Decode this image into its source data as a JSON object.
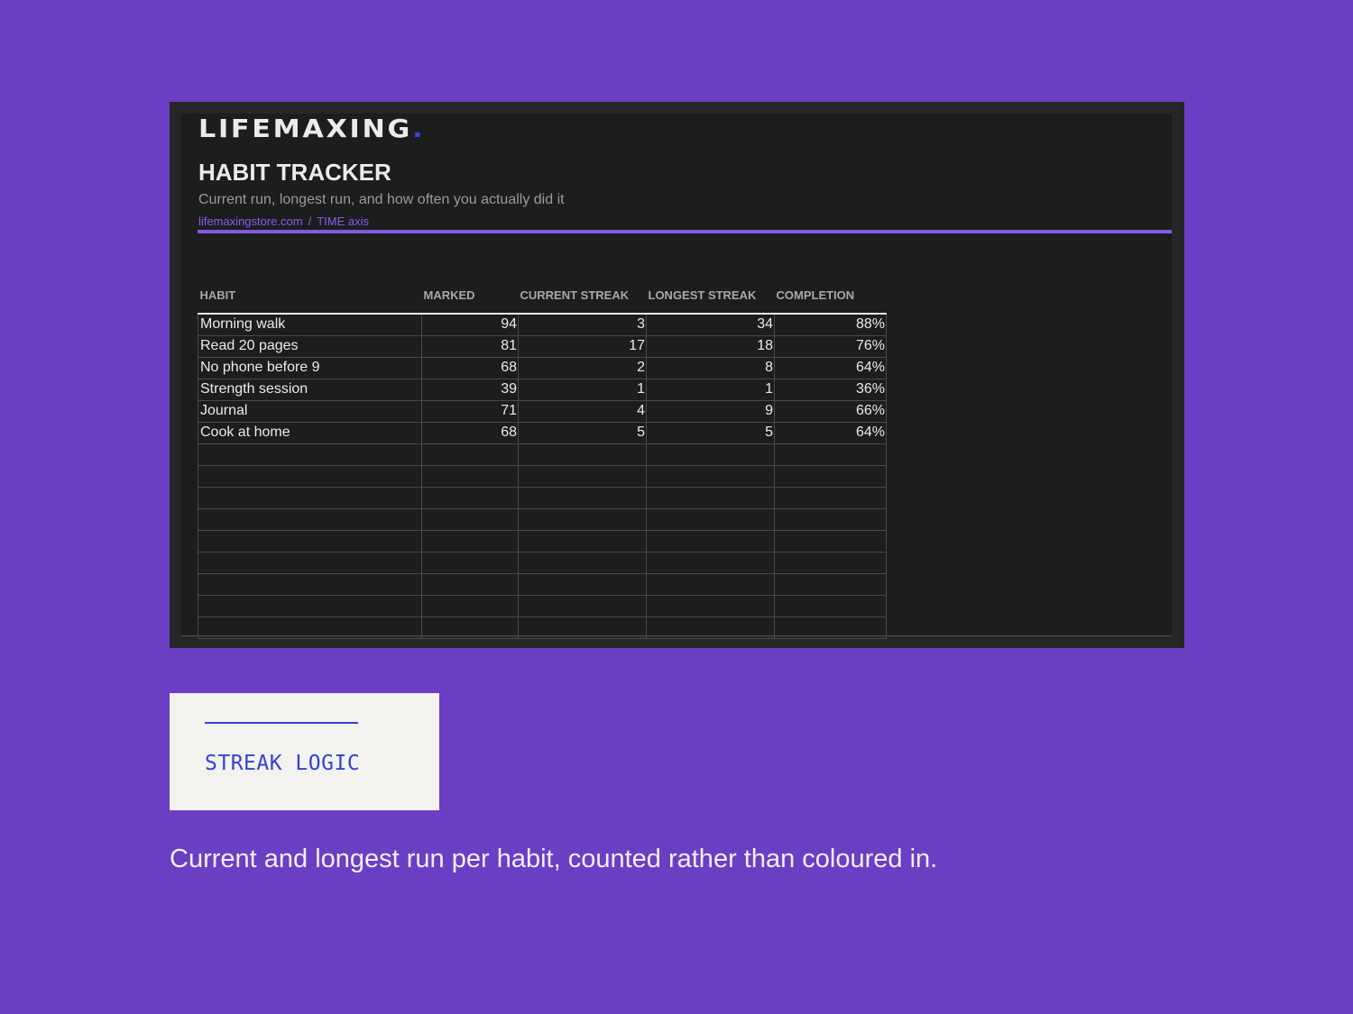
{
  "brand": {
    "name": "LIFEMAXING",
    "dot": "."
  },
  "header": {
    "title": "HABIT TRACKER",
    "subtitle": "Current run, longest run, and how often you actually did it",
    "source_site": "lifemaxingstore.com",
    "source_separator": "/",
    "source_axis": "TIME axis"
  },
  "table": {
    "columns": [
      "HABIT",
      "MARKED",
      "CURRENT STREAK",
      "LONGEST STREAK",
      "COMPLETION"
    ],
    "rows": [
      [
        "Morning walk",
        "94",
        "3",
        "34",
        "88%"
      ],
      [
        "Read 20 pages",
        "81",
        "17",
        "18",
        "76%"
      ],
      [
        "No phone before 9",
        "68",
        "2",
        "8",
        "64%"
      ],
      [
        "Strength session",
        "39",
        "1",
        "1",
        "36%"
      ],
      [
        "Journal",
        "71",
        "4",
        "9",
        "66%"
      ],
      [
        "Cook at home",
        "68",
        "5",
        "5",
        "64%"
      ]
    ],
    "empty_row_count": 9
  },
  "streak_card": {
    "label": "STREAK LOGIC"
  },
  "caption": "Current and longest run per habit, counted rather than coloured in.",
  "colors": {
    "background": "#6b3fc4",
    "sheet": "#1c1d1d",
    "accent_purple": "#8659e0",
    "accent_blue": "#3243d1"
  }
}
